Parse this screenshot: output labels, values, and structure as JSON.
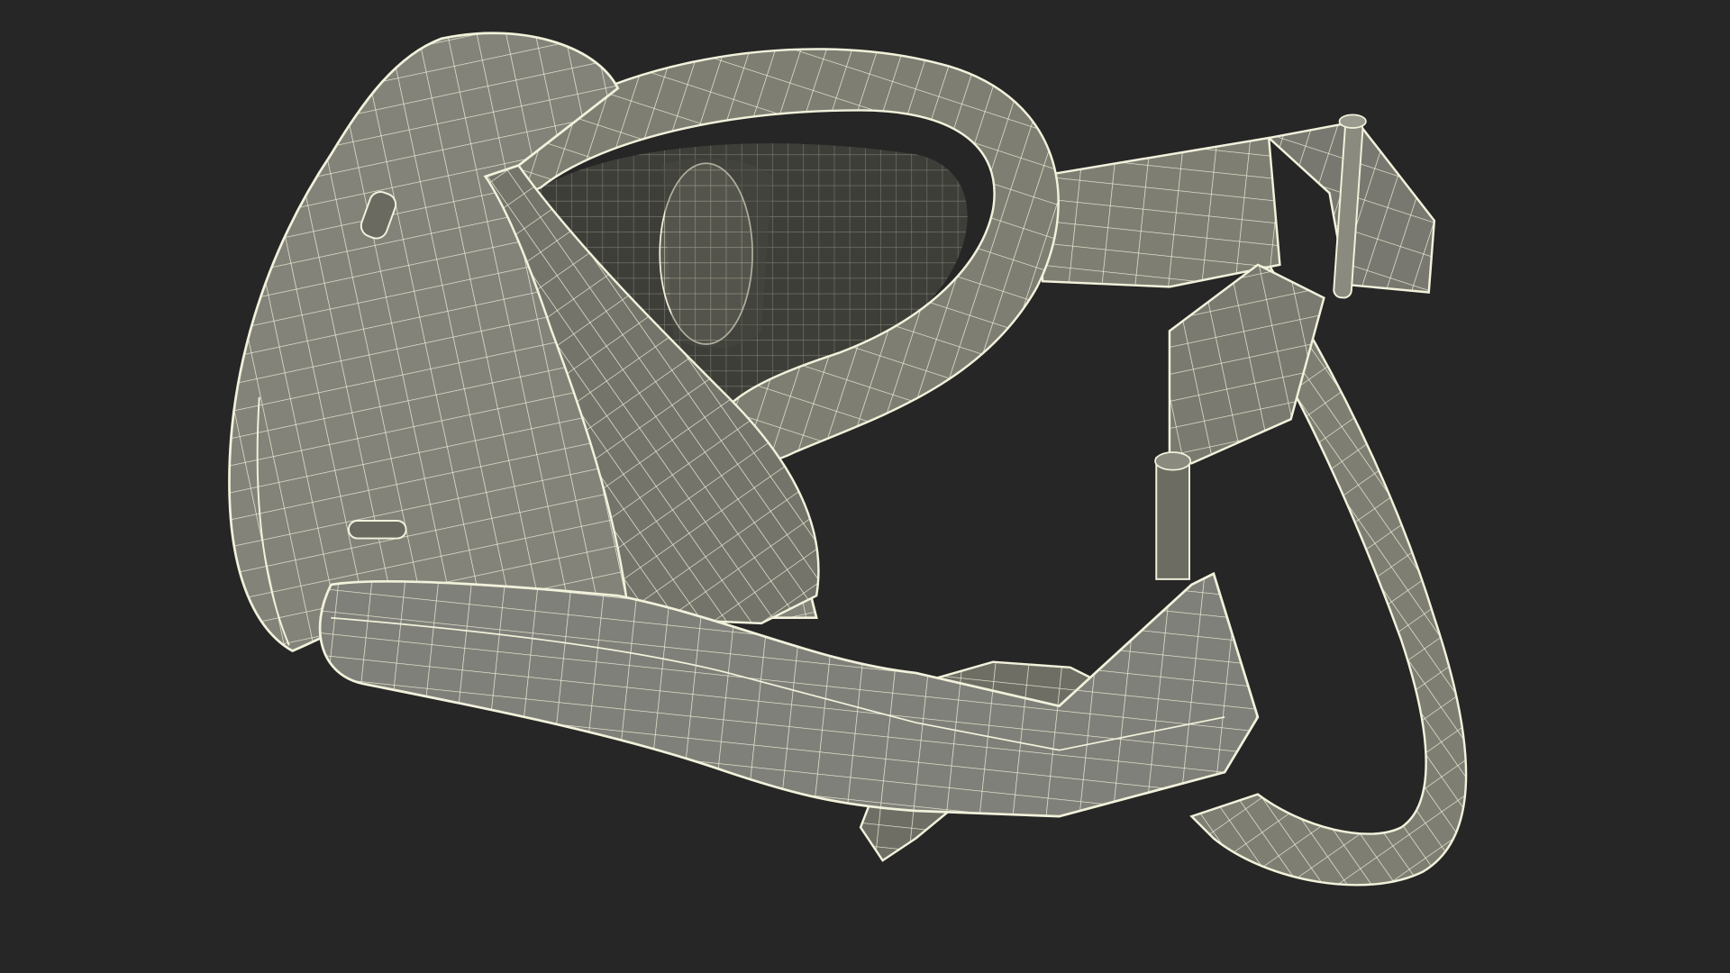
{
  "scene": {
    "subject": "vr-headset-wireframe",
    "colors": {
      "background": "#262626",
      "surface": "#85857a",
      "surface_shadow": "#6c6c62",
      "surface_dark": "#55554d",
      "wire": "#f2f2dc",
      "interior": "#3e3e39"
    }
  }
}
